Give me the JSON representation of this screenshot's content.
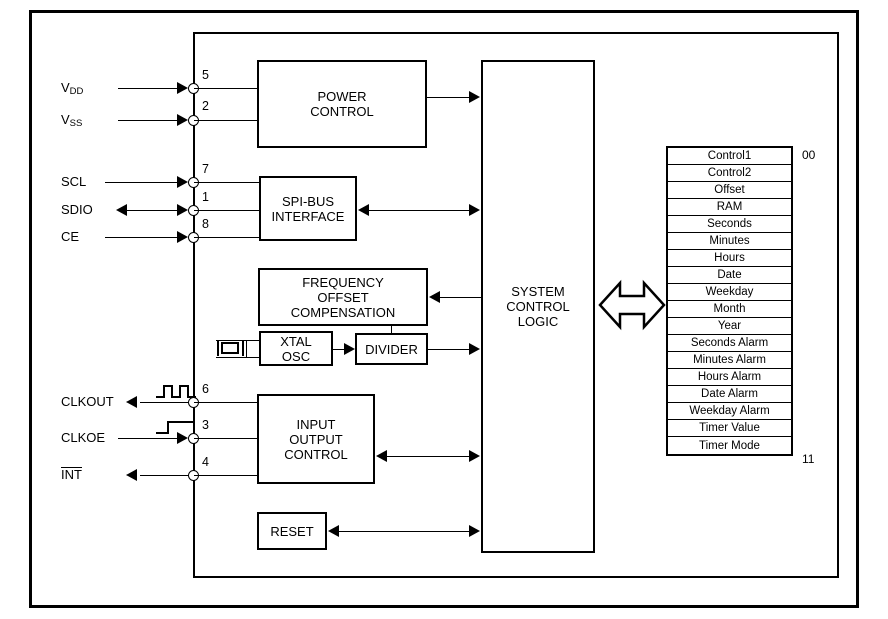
{
  "diagram": {
    "title": "RTC block diagram",
    "colors": {
      "line": "#000000",
      "background": "#ffffff",
      "text": "#000000"
    }
  },
  "signals": [
    {
      "name": "VDD",
      "label": "V",
      "sub": "DD",
      "pin": "5",
      "direction": "in"
    },
    {
      "name": "VSS",
      "label": "V",
      "sub": "SS",
      "pin": "2",
      "direction": "in"
    },
    {
      "name": "SCL",
      "label": "SCL",
      "sub": "",
      "pin": "7",
      "direction": "in"
    },
    {
      "name": "SDIO",
      "label": "SDIO",
      "sub": "",
      "pin": "1",
      "direction": "bidir"
    },
    {
      "name": "CE",
      "label": "CE",
      "sub": "",
      "pin": "8",
      "direction": "in"
    },
    {
      "name": "CLKOUT",
      "label": "CLKOUT",
      "sub": "",
      "pin": "6",
      "direction": "out"
    },
    {
      "name": "CLKOE",
      "label": "CLKOE",
      "sub": "",
      "pin": "3",
      "direction": "in"
    },
    {
      "name": "INT",
      "label": "INT",
      "sub": "",
      "pin": "4",
      "direction": "out"
    }
  ],
  "blocks": {
    "power_control": {
      "lines": [
        "POWER",
        "CONTROL"
      ]
    },
    "spi_interface": {
      "lines": [
        "SPI-BUS",
        "INTERFACE"
      ]
    },
    "freq_offset": {
      "lines": [
        "FREQUENCY",
        "OFFSET",
        "COMPENSATION"
      ]
    },
    "xtal_osc": {
      "lines": [
        "XTAL",
        "OSC"
      ]
    },
    "divider": {
      "lines": [
        "DIVIDER"
      ]
    },
    "system_control": {
      "lines": [
        "SYSTEM",
        "CONTROL",
        "LOGIC"
      ]
    },
    "io_control": {
      "lines": [
        "INPUT",
        "OUTPUT",
        "CONTROL"
      ]
    },
    "reset": {
      "lines": [
        "RESET"
      ]
    }
  },
  "registers": {
    "start_address": "00",
    "end_address": "11",
    "rows": [
      "Control1",
      "Control2",
      "Offset",
      "RAM",
      "Seconds",
      "Minutes",
      "Hours",
      "Date",
      "Weekday",
      "Month",
      "Year",
      "Seconds Alarm",
      "Minutes Alarm",
      "Hours Alarm",
      "Date Alarm",
      "Weekday Alarm",
      "Timer Value",
      "Timer Mode"
    ]
  }
}
